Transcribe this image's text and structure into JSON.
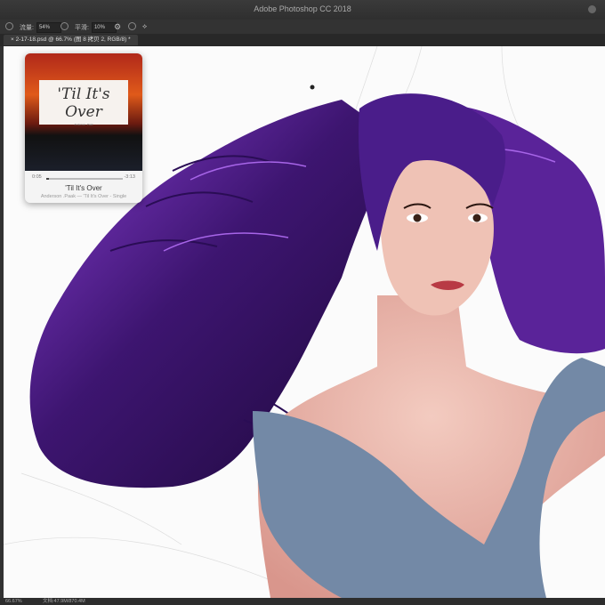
{
  "window": {
    "title": "Adobe Photoshop CC 2018"
  },
  "options": {
    "opacity_label": "流量:",
    "opacity_value": "54%",
    "smooth_label": "平滑:",
    "smooth_value": "10%"
  },
  "document_tab": {
    "label": "2-17-18.psd @ 66.7% (图 8 拷贝 2, RGB/8) *"
  },
  "mini_player": {
    "album_title": "'Til It's Over",
    "album_subtitle": "Anderson .Paak",
    "elapsed": "0:05",
    "remaining": "-3:13",
    "song": "'Til It's Over",
    "artist_line": "Anderson .Paak — 'Til It's Over - Single",
    "progress": 0.03
  },
  "status": {
    "zoom": "66.67%",
    "doc_info": "文档:47.9M/870.4M"
  },
  "colors": {
    "hair": "#4a1d8a",
    "hair_highlight": "#9b4be0",
    "skin": "#e6b4aa",
    "dress": "#7389a6",
    "canvas": "#fbfbfb"
  },
  "icons": [
    "brush-tool-icon",
    "pressure-icon",
    "settings-gear-icon",
    "symmetry-icon"
  ]
}
